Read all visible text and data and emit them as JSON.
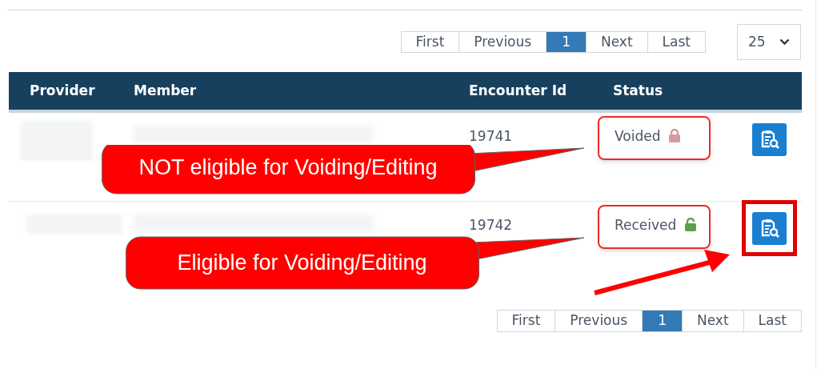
{
  "pager_top": {
    "pages": [
      {
        "label": "First",
        "selected": false
      },
      {
        "label": "Previous",
        "selected": false
      },
      {
        "label": "1",
        "selected": true
      },
      {
        "label": "Next",
        "selected": false
      },
      {
        "label": "Last",
        "selected": false
      }
    ],
    "page_size": "25"
  },
  "table": {
    "columns": [
      "Provider",
      "Member",
      "Encounter Id",
      "Status"
    ],
    "rows": [
      {
        "encounter_id": "19741",
        "status": "Voided",
        "locked": true,
        "status_highlighted": true,
        "action_highlighted": false
      },
      {
        "encounter_id": "19742",
        "status": "Received",
        "locked": false,
        "status_highlighted": true,
        "action_highlighted": true
      }
    ]
  },
  "callouts": [
    {
      "text": "NOT eligible for Voiding/Editing"
    },
    {
      "text": "Eligible for Voiding/Editing"
    }
  ],
  "pager_bottom": {
    "pages": [
      {
        "label": "First",
        "selected": false
      },
      {
        "label": "Previous",
        "selected": false
      },
      {
        "label": "1",
        "selected": true
      },
      {
        "label": "Next",
        "selected": false
      },
      {
        "label": "Last",
        "selected": false
      }
    ]
  }
}
